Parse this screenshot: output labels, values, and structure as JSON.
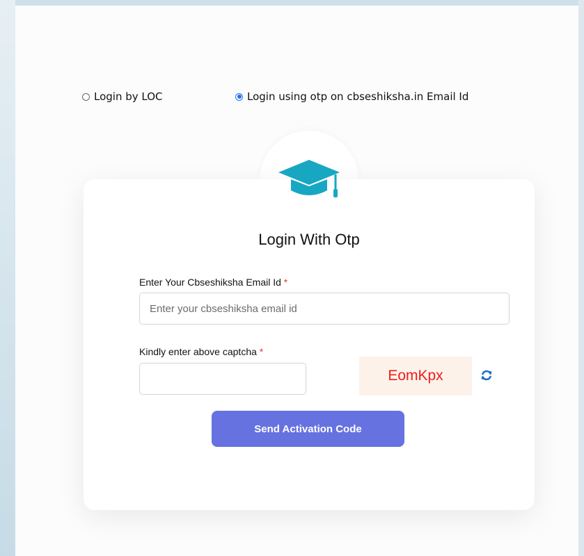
{
  "login_mode": {
    "options": [
      {
        "label": "Login by LOC",
        "selected": false
      },
      {
        "label": "Login using otp on cbseshiksha.in Email Id",
        "selected": true
      }
    ]
  },
  "form": {
    "title": "Login With Otp",
    "email": {
      "label": "Enter Your Cbseshiksha Email Id",
      "required_mark": "*",
      "placeholder": "Enter your cbseshiksha email id",
      "value": ""
    },
    "captcha": {
      "label": "Kindly enter above captcha",
      "required_mark": "*",
      "value": "",
      "code": "EomKpx",
      "code_color": "#ee1c1c"
    },
    "submit_label": "Send Activation Code"
  },
  "icons": {
    "header": "graduation-cap-icon",
    "refresh": "refresh-icon"
  },
  "colors": {
    "accent": "#6672e0",
    "icon_teal": "#17a7c2",
    "required": "#e53935",
    "radio_selected": "#1a73e8"
  }
}
